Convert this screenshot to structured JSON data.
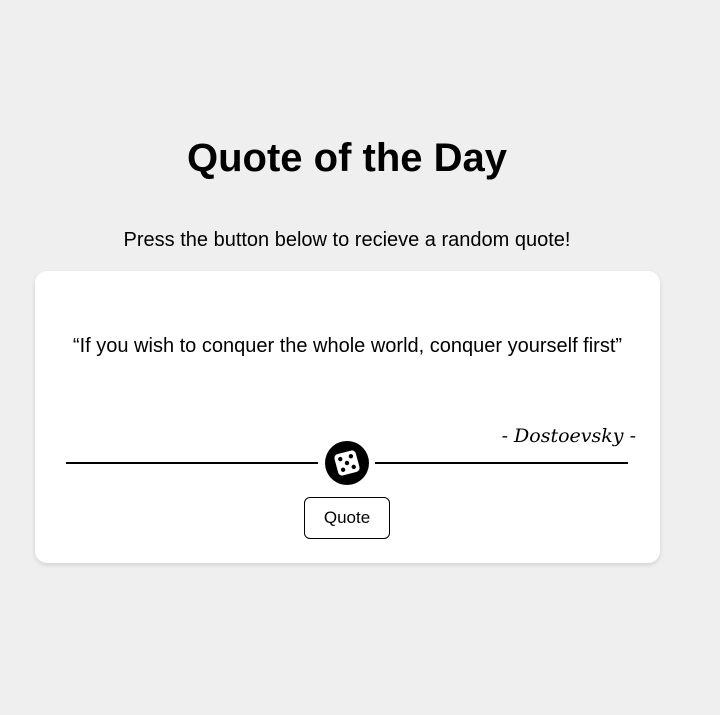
{
  "header": {
    "title": "Quote of the Day",
    "subtitle": "Press the button below to recieve a random quote!"
  },
  "quote_card": {
    "quote": "“If you wish to conquer the whole world, conquer yourself first”",
    "author": "- Dostoevsky -",
    "dice_icon": "dice-icon",
    "button_label": "Quote"
  },
  "colors": {
    "background": "#efefef",
    "card": "#ffffff",
    "text": "#000000"
  }
}
